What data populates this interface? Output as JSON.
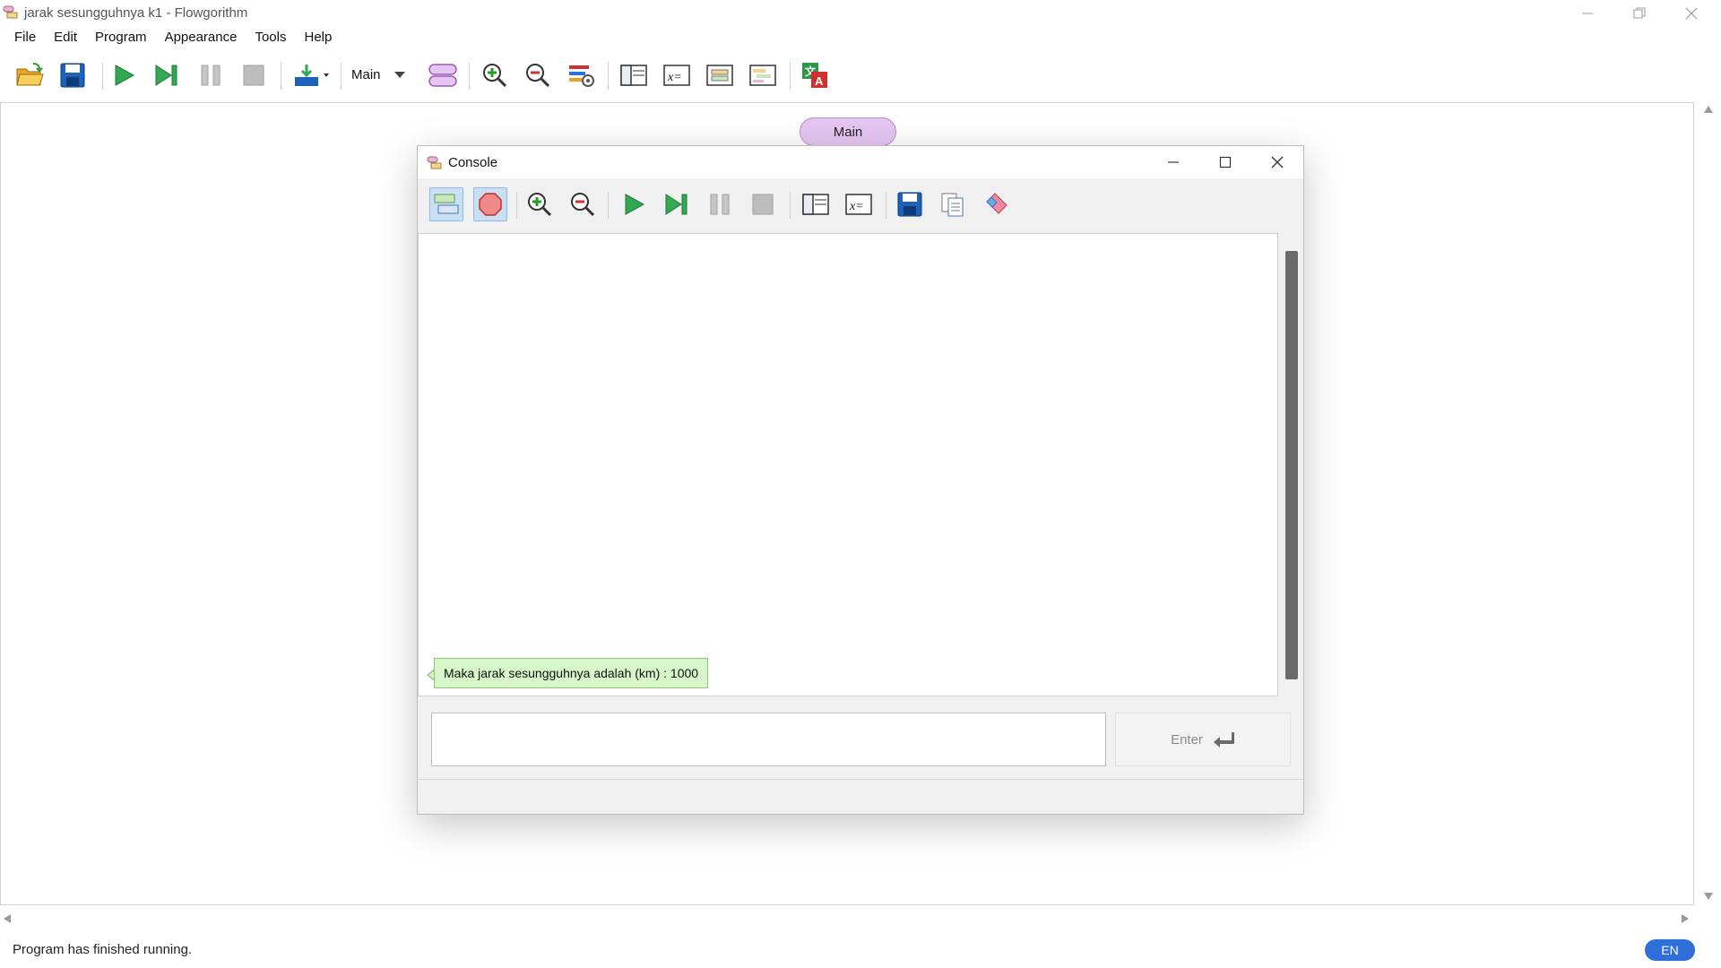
{
  "window": {
    "title": "jarak sesungguhnya k1 - Flowgorithm"
  },
  "menu": [
    "File",
    "Edit",
    "Program",
    "Appearance",
    "Tools",
    "Help"
  ],
  "toolbar": {
    "function_select": "Main",
    "icons": [
      "open-folder-icon",
      "save-icon",
      "run-icon",
      "step-icon",
      "pause-icon",
      "stop-icon",
      "run-speed-icon",
      "function-select",
      "add-function-icon",
      "zoom-in-icon",
      "zoom-out-icon",
      "layout-settings-icon",
      "variable-watch-icon",
      "expression-icon",
      "source-view-icon",
      "chart-view-icon",
      "translate-icon"
    ]
  },
  "flowchart": {
    "start_label": "Main"
  },
  "console": {
    "title": "Console",
    "output": [
      "Maka jarak sesungguhnya adalah (km) : 1000"
    ],
    "input_value": "",
    "enter_label": "Enter"
  },
  "status": {
    "text": "Program has finished running.",
    "language": "EN"
  },
  "colors": {
    "main_terminal": "#e5c6f2",
    "output_bubble": "#d6f5c9",
    "language_badge": "#2f6fd9",
    "scroll_thumb": "#6b6b6b"
  }
}
